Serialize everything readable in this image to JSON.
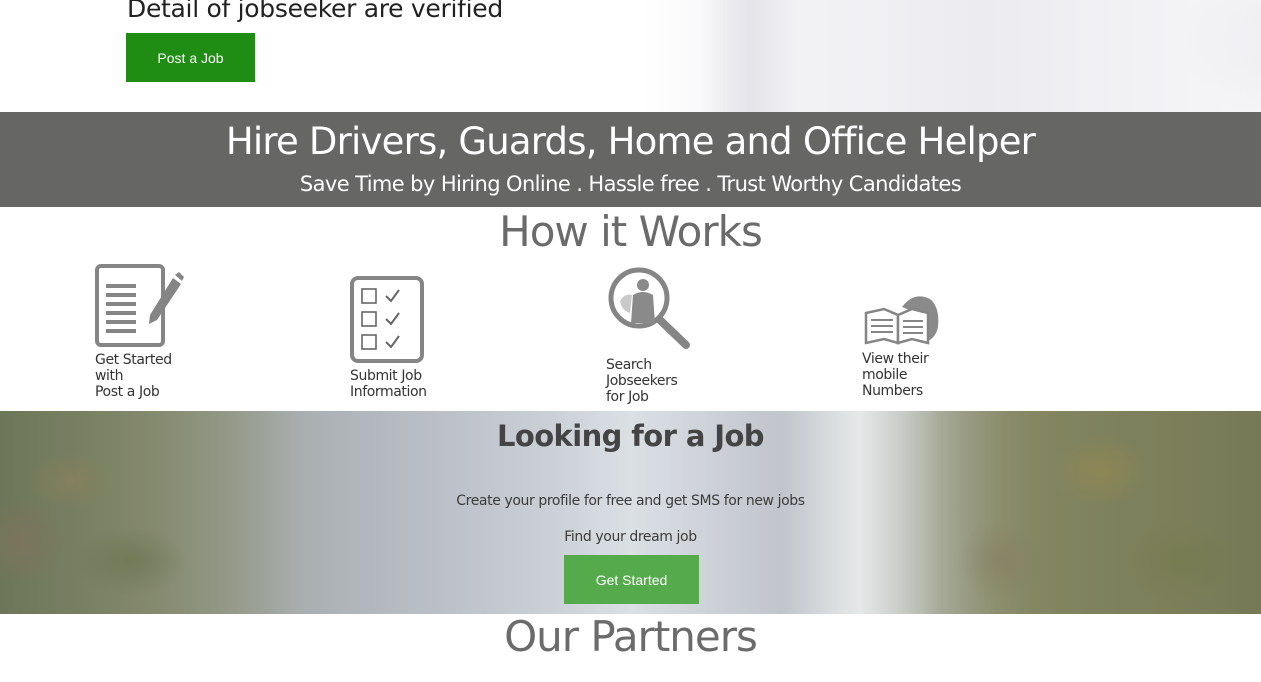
{
  "hero": {
    "title": "Detail of jobseeker are verified",
    "post_job_label": "Post a Job"
  },
  "banner": {
    "title": "Hire Drivers, Guards, Home and Office Helper",
    "subtitle": "Save Time by Hiring Online . Hassle free . Trust Worthy Candidates"
  },
  "how_it_works": {
    "title": "How it Works",
    "steps": [
      {
        "icon": "document-pencil-icon",
        "lines": [
          "Get Started",
          "with",
          "Post a Job"
        ]
      },
      {
        "icon": "checklist-icon",
        "lines": [
          "Submit Job",
          "Information"
        ]
      },
      {
        "icon": "search-person-icon",
        "lines": [
          "Search",
          "Jobseekers",
          "for Job"
        ]
      },
      {
        "icon": "phone-book-icon",
        "lines": [
          "View their",
          "mobile",
          "Numbers"
        ]
      }
    ]
  },
  "looking": {
    "title": "Looking for a Job",
    "line1": "Create your profile for free and get SMS for new jobs",
    "line2": "Find your dream job",
    "button_label": "Get Started"
  },
  "partners": {
    "title": "Our Partners"
  },
  "colors": {
    "post_job_button": "#1f8c13",
    "get_started_button": "#55aa4b",
    "banner_bg": "#666665",
    "section_title": "#6b6b6b",
    "icon_gray": "#858585"
  }
}
